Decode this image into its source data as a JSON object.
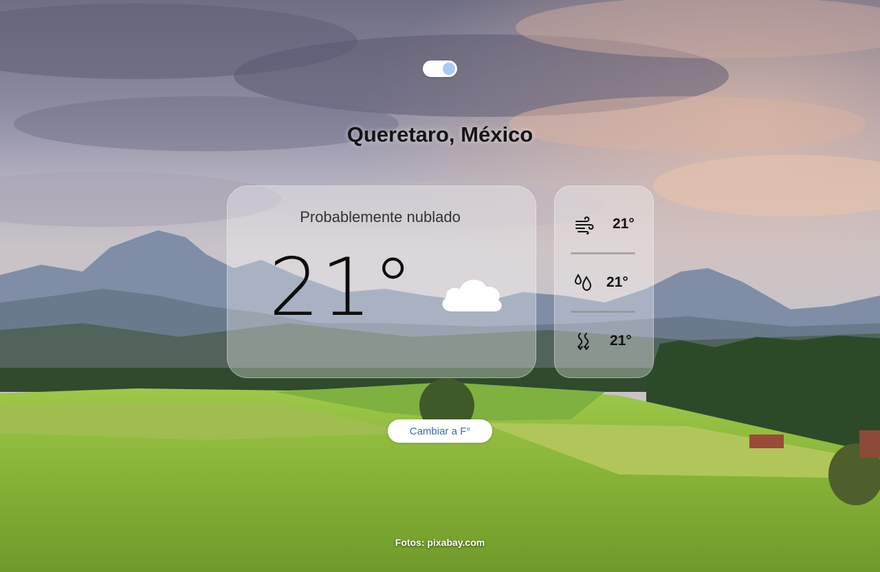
{
  "location": {
    "city": "Queretaro, México"
  },
  "theme_toggle": {
    "state": "on"
  },
  "weather": {
    "description": "Probablemente nublado",
    "temperature": "21°",
    "condition_icon": "cloud-icon"
  },
  "details": [
    {
      "icon": "wind-icon",
      "value": "21°"
    },
    {
      "icon": "humidity-icon",
      "value": "21°"
    },
    {
      "icon": "heat-wave-icon",
      "value": "21°"
    }
  ],
  "unit_button": {
    "label": "Cambiar a F°"
  },
  "footer": {
    "credit": "Fotos: pixabay.com"
  },
  "colors": {
    "toggle_knob": "#a9c9f2",
    "button_text": "#3b6aa8",
    "card_glass": "rgba(255,255,255,0.32)"
  }
}
